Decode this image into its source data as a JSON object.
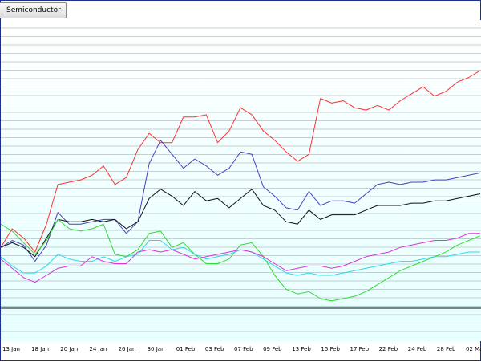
{
  "toolbar": {
    "semiconductor_label": "Semiconductor"
  },
  "chart_data": {
    "type": "line",
    "x_tick_labels": [
      "13 Jan",
      "18 Jan",
      "20 Jan",
      "24 Jan",
      "26 Jan",
      "30 Jan",
      "01 Feb",
      "03 Feb",
      "07 Feb",
      "09 Feb",
      "13 Feb",
      "15 Feb",
      "17 Feb",
      "22 Feb",
      "24 Feb",
      "28 Feb",
      "02 Mar"
    ],
    "n_points": 43,
    "ylim": [
      0,
      100
    ],
    "baseline_value": 12,
    "grid": true,
    "background_color": "#e6ffff",
    "grid_color": "#9aa0a6",
    "series": [
      {
        "color": "#ff3030",
        "values": [
          32,
          40,
          36,
          30,
          42,
          59,
          60,
          61,
          63,
          67,
          59,
          62,
          74,
          81,
          77,
          77,
          88,
          88,
          89,
          77,
          82,
          92,
          89,
          82,
          78,
          73,
          69,
          72,
          96,
          94,
          95,
          92,
          91,
          93,
          91,
          95,
          98,
          101,
          97,
          99,
          103,
          105,
          108
        ]
      },
      {
        "color": "#4a3fbf",
        "values": [
          32,
          35,
          33,
          26,
          33,
          47,
          42,
          42,
          43,
          44,
          44,
          38,
          43,
          68,
          78,
          72,
          66,
          70,
          67,
          63,
          66,
          73,
          72,
          58,
          54,
          49,
          48,
          56,
          50,
          52,
          52,
          51,
          55,
          59,
          60,
          59,
          60,
          60,
          61,
          61,
          62,
          63,
          64
        ]
      },
      {
        "color": "#101010",
        "values": [
          32,
          34,
          32,
          28,
          36,
          44,
          43,
          43,
          44,
          43,
          44,
          40,
          43,
          53,
          57,
          54,
          50,
          56,
          52,
          53,
          49,
          53,
          57,
          50,
          48,
          43,
          42,
          48,
          44,
          46,
          46,
          46,
          48,
          50,
          50,
          50,
          51,
          51,
          52,
          52,
          53,
          54,
          55
        ]
      },
      {
        "color": "#30dd30",
        "values": [
          42,
          39,
          34,
          29,
          35,
          44,
          40,
          39,
          40,
          42,
          29,
          28,
          31,
          38,
          39,
          32,
          34,
          29,
          25,
          25,
          27,
          33,
          34,
          28,
          20,
          14,
          12,
          13,
          10,
          9,
          10,
          11,
          13,
          16,
          19,
          22,
          24,
          26,
          28,
          30,
          33,
          35,
          37
        ]
      },
      {
        "color": "#30d8e8",
        "values": [
          28,
          24,
          21,
          21,
          24,
          29,
          27,
          26,
          26,
          28,
          26,
          28,
          29,
          35,
          35,
          31,
          32,
          29,
          27,
          28,
          29,
          31,
          30,
          27,
          24,
          21,
          20,
          21,
          20,
          20,
          21,
          22,
          23,
          24,
          25,
          26,
          26,
          27,
          28,
          28,
          29,
          30,
          30
        ]
      },
      {
        "color": "#e030e0",
        "values": [
          27,
          23,
          19,
          17,
          20,
          23,
          24,
          24,
          28,
          26,
          25,
          25,
          30,
          31,
          30,
          31,
          29,
          27,
          28,
          29,
          30,
          31,
          30,
          28,
          25,
          22,
          23,
          24,
          24,
          23,
          24,
          26,
          28,
          29,
          30,
          32,
          33,
          34,
          35,
          35,
          36,
          38,
          38
        ]
      }
    ]
  }
}
